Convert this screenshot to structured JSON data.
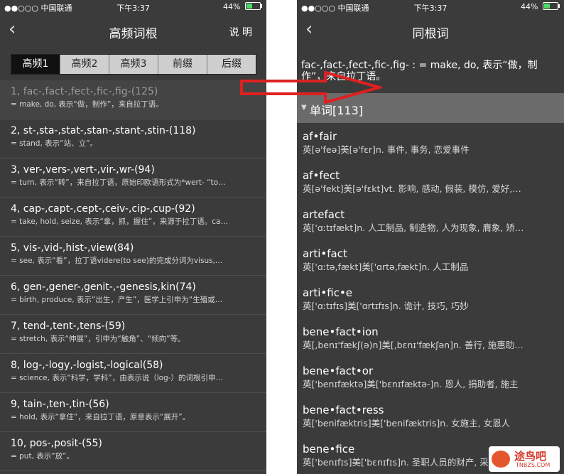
{
  "left": {
    "status": {
      "carrier": "●●○○○ 中国联通",
      "time": "下午3:37",
      "battery": "44%",
      "battery_level": 0.44
    },
    "nav": {
      "back_icon": "chevron-left-icon",
      "title": "高频词根",
      "right": "说 明"
    },
    "tabs": [
      "高频1",
      "高频2",
      "高频3",
      "前缀",
      "后缀"
    ],
    "roots": [
      {
        "main": "1, fac-,fact-,fect-,fic-,fig-(125)",
        "sub": "= make, do, 表示“做，制作”，来自拉丁语。"
      },
      {
        "main": "2, st-,sta-,stat-,stan-,stant-,stin-(118)",
        "sub": "= stand, 表示“站、立”。"
      },
      {
        "main": "3, ver-,vers-,vert-,vir-,wr-(94)",
        "sub": "= turn, 表示“转”，来自拉丁语，原始印欧语形式为*wert- “to…"
      },
      {
        "main": "4, cap-,capt-,cept-,ceiv-,cip-,cup-(92)",
        "sub": "= take, hold, seize, 表示“拿，抓，握住”，来源于拉丁语。ca…"
      },
      {
        "main": "5, vis-,vid-,hist-,view(84)",
        "sub": "= see, 表示“看”，拉丁语videre(to see)的完成分词为visus,…"
      },
      {
        "main": "6, gen-,gener-,genit-,-genesis,kin(74)",
        "sub": "= birth, produce, 表示“出生，产生”，医学上引申为“生殖或…"
      },
      {
        "main": "7, tend-,tent-,tens-(59)",
        "sub": "= stretch, 表示“伸展”，引申为“触角”、“倾向”等。"
      },
      {
        "main": "8, log-,-logy,-logist,-logical(58)",
        "sub": "= science, 表示“科学，学科”，由表示说（log-）的词根引申…"
      },
      {
        "main": "9, tain-,ten-,tin-(56)",
        "sub": "= hold, 表示“拿住”，来自拉丁语，原意表示“展开”。"
      },
      {
        "main": "10, pos-,posit-(55)",
        "sub": "= put, 表示“放”。"
      }
    ]
  },
  "right": {
    "status": {
      "carrier": "●●○○○ 中国联通",
      "time": "下午3:37",
      "battery": "44%",
      "battery_level": 0.44
    },
    "nav": {
      "back_icon": "chevron-left-icon",
      "title": "同根词"
    },
    "description": "fac-,fact-,fect-,fic-,fig- : = make, do, 表示“做，制作”，来自拉丁语。",
    "section": {
      "icon": "triangle-down-icon",
      "label": "单词[113]"
    },
    "words": [
      {
        "word": "af•fair",
        "meaning": "英[ə'feə]美[ə'fɛr]n. 事件, 事务, 恋爱事件"
      },
      {
        "word": "af•fect",
        "meaning": "英[ə'fekt]美[ə'fɛkt]vt. 影响, 感动, 假装, 模仿, 爱好,…"
      },
      {
        "word": "artefact",
        "meaning": "英['ɑːtɪfækt]n. 人工制品, 制造物, 人为现象, 膺象, 矫…"
      },
      {
        "word": "arti•fact",
        "meaning": "英['ɑːtə,fækt]美['ɑrtə,fækt]n. 人工制品"
      },
      {
        "word": "arti•fic•e",
        "meaning": "英['ɑːtɪfɪs]美['ɑrtɪfɪs]n. 诡计, 技巧, 巧妙"
      },
      {
        "word": "bene•fact•ion",
        "meaning": "英[,benɪ'fækʃ(ə)n]美[,bɛnɪ'fækʃən]n. 善行, 施惠助…"
      },
      {
        "word": "bene•fact•or",
        "meaning": "英['benɪfæktə]美['bɛnɪfæktə-]n. 恩人, 捐助者, 施主"
      },
      {
        "word": "bene•fact•ress",
        "meaning": "英['benifæktris]美['benifæktris]n. 女施主, 女恩人"
      },
      {
        "word": "bene•fice",
        "meaning": "英['benɪfɪs]美['bɛnɪfɪs]n. 圣职人员的财产, 采邑…"
      }
    ]
  },
  "arrow": {
    "icon": "right-arrow-icon",
    "color": "#e02020"
  },
  "watermark": {
    "icon": "tuniaoba-logo-icon",
    "text": "途鸟吧",
    "sub": "TNBZS.COM"
  },
  "colors": {
    "panel_bg": "#3b3b3b",
    "section_bg": "#6b6b6b",
    "tab_active_bg": "#111111",
    "tab_bg": "#cfcfcf"
  }
}
